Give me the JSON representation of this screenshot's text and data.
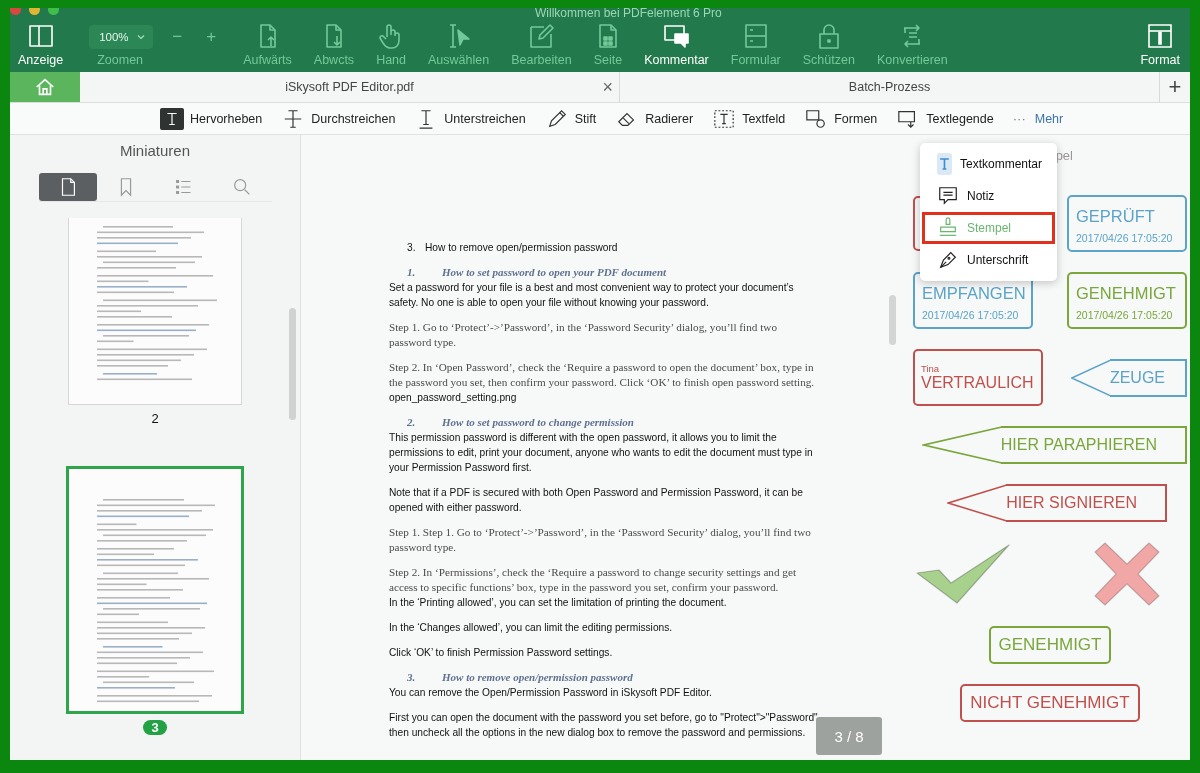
{
  "window": {
    "title": "Willkommen bei PDFelement 6 Pro"
  },
  "toolbar": {
    "zoom": {
      "value": "100%",
      "label": "Zoomen",
      "minus": "−",
      "plus": "+"
    },
    "items": [
      {
        "kind": "layout",
        "label": "Anzeige",
        "selected": true
      },
      {
        "kind": "zoom"
      },
      {
        "kind": "pageup",
        "label": "Aufwärts",
        "selected": false
      },
      {
        "kind": "pagedown",
        "label": "Abwcts",
        "selected": false
      },
      {
        "kind": "hand",
        "label": "Hand",
        "selected": false
      },
      {
        "kind": "select",
        "label": "Auswählen",
        "selected": false
      },
      {
        "kind": "edit",
        "label": "Bearbeiten",
        "selected": false
      },
      {
        "kind": "page",
        "label": "Seite",
        "selected": false
      },
      {
        "kind": "comment",
        "label": "Kommentar",
        "selected": true
      },
      {
        "kind": "form",
        "label": "Formular",
        "selected": false
      },
      {
        "kind": "lock",
        "label": "Schützen",
        "selected": false
      },
      {
        "kind": "convert",
        "label": "Konvertieren",
        "selected": false
      }
    ],
    "right_items": [
      {
        "kind": "info",
        "label": "Format",
        "selected": true
      }
    ]
  },
  "tabs": [
    {
      "kind": "home"
    },
    {
      "kind": "document",
      "label": "iSkysoft PDF Editor.pdf",
      "close": "×"
    },
    {
      "kind": "document",
      "label": "Batch-Prozess"
    }
  ],
  "new_tab": "+",
  "annotation_tools": [
    {
      "kind": "highlight",
      "label": "Hervorheben",
      "selected": true
    },
    {
      "kind": "strike",
      "label": "Durchstreichen",
      "selected": false
    },
    {
      "kind": "underline",
      "label": "Unterstreichen",
      "selected": false
    },
    {
      "kind": "pen",
      "label": "Stift",
      "selected": false
    },
    {
      "kind": "eraser",
      "label": "Radierer",
      "selected": false
    },
    {
      "kind": "textfield",
      "label": "Textfeld",
      "selected": false
    },
    {
      "kind": "shapes",
      "label": "Formen",
      "selected": false
    },
    {
      "kind": "callout",
      "label": "Textlegende",
      "selected": false
    }
  ],
  "more": {
    "dots": "···",
    "label": "Mehr"
  },
  "more_menu": [
    {
      "kind": "textcomment",
      "label": "Textkommentar",
      "selected": false
    },
    {
      "kind": "note",
      "label": "Notiz",
      "selected": false
    },
    {
      "kind": "stamp",
      "label": "Stempel",
      "selected": true
    },
    {
      "kind": "signature",
      "label": "Unterschrift",
      "selected": false
    }
  ],
  "sidebar": {
    "title": "Miniaturen",
    "tabs": [
      {
        "kind": "docpage",
        "selected": true
      },
      {
        "kind": "bookmark",
        "selected": false
      },
      {
        "kind": "list",
        "selected": false
      },
      {
        "kind": "search",
        "selected": false
      }
    ],
    "thumbnails": [
      {
        "label": "2",
        "selected": false
      },
      {
        "label": "3",
        "selected": true
      }
    ]
  },
  "document": {
    "paragraphs": [
      {
        "kind": "item",
        "number": "3.",
        "text": "How to remove open/permission password"
      },
      {
        "kind": "heading",
        "number": "1.",
        "text": "How to set password to open your PDF document"
      },
      {
        "kind": "para",
        "text": "Set a password for your file is a best and most convenient way to protect your document’s safety. No one is able to open your file without knowing your password."
      },
      {
        "kind": "serif",
        "text": "Step 1. Go to ‘Protect’->’Password’, in the ‘Password Security’ dialog, you’ll find two password type."
      },
      {
        "kind": "serif",
        "text": "Step 2. In ‘Open Password’, check the ‘Require a password to open the document’ box, type in the password you set, then confirm your password. Click ‘OK’ to finish open password setting."
      },
      {
        "kind": "para",
        "text": "open_password_setting.png"
      },
      {
        "kind": "heading",
        "number": "2.",
        "text": "How to set password to change permission"
      },
      {
        "kind": "para",
        "text": "This permission password is different with the open password, it allows you to limit the permissions to edit, print your document, anyone who wants to edit the document must type in your Permission Password first."
      },
      {
        "kind": "para",
        "text": "Note that if a PDF is secured with both Open Password and Permission Password, it can be opened with either password."
      },
      {
        "kind": "serif",
        "text": "Step 1. Step 1. Go to ‘Protect’->’Password’, in the ‘Password Security’ dialog, you’ll find two password type."
      },
      {
        "kind": "serif",
        "text": "Step 2. In ‘Permissions’, check the ‘Require a password to change security settings and get access to specific functions’ box, type in the password you set, confirm your password."
      },
      {
        "kind": "para",
        "text": "In the ‘Printing allowed’, you can set the limitation of printing the document."
      },
      {
        "kind": "para",
        "text": "In the ‘Changes allowed’, you can limit the editing permissions."
      },
      {
        "kind": "para",
        "text": "Click ‘OK’ to finish Permission Password settings."
      },
      {
        "kind": "heading",
        "number": "3.",
        "text": "How to remove open/permission password"
      },
      {
        "kind": "para",
        "text": "You can remove the Open/Permission Password in iSkysoft PDF Editor."
      },
      {
        "kind": "para",
        "text": "First you can open the document with the password you set before, go to \"Protect\">\"Password\", then uncheck all the options in the new dialog box to remove the password and permissions."
      }
    ],
    "page_indicator": "3 / 8"
  },
  "stamp_panel": {
    "title": "pel",
    "stamps": [
      {
        "kind": "box",
        "color": "#c0504d"
      },
      {
        "kind": "box",
        "text": "GEPRÜFT",
        "date": "2017/04/26 17:05:20",
        "color": "#5ba3c9"
      },
      {
        "kind": "box",
        "text": "EMPFANGEN",
        "date": "2017/04/26 17:05:20",
        "color": "#5ba3c9"
      },
      {
        "kind": "box",
        "text": "GENEHMIGT",
        "date": "2017/04/26 17:05:20",
        "color": "#7aa63c"
      },
      {
        "kind": "box",
        "note": "Tina",
        "text": "VERTRAULICH",
        "color": "#c0504d"
      },
      {
        "kind": "arrow",
        "text": "ZEUGE",
        "color": "#5ba3c9"
      },
      {
        "kind": "arrow",
        "text": "HIER PARAPHIEREN",
        "color": "#7aa63c"
      },
      {
        "kind": "arrow",
        "text": "HIER SIGNIEREN",
        "color": "#c0504d"
      },
      {
        "kind": "check",
        "color": "#a9d18e"
      },
      {
        "kind": "cross",
        "color": "#f2a7a7"
      },
      {
        "kind": "box",
        "text": "GENEHMIGT",
        "color": "#7aa63c"
      },
      {
        "kind": "box",
        "text": "NICHT GENEHMIGT",
        "color": "#c0504d"
      }
    ]
  }
}
